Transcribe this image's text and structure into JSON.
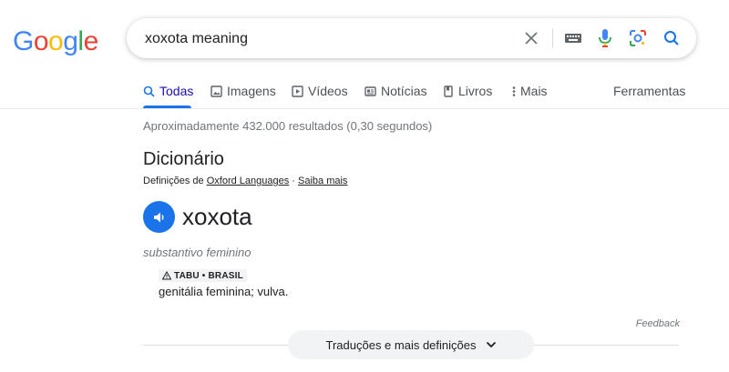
{
  "logo": {
    "letters": [
      "G",
      "o",
      "o",
      "g",
      "l",
      "e"
    ],
    "colors": [
      "#4285F4",
      "#EA4335",
      "#FBBC05",
      "#4285F4",
      "#34A853",
      "#EA4335"
    ]
  },
  "search": {
    "query": "xoxota meaning"
  },
  "tabs": [
    {
      "label": "Todas",
      "icon": "search-icon"
    },
    {
      "label": "Imagens",
      "icon": "image-icon"
    },
    {
      "label": "Vídeos",
      "icon": "video-icon"
    },
    {
      "label": "Notícias",
      "icon": "news-icon"
    },
    {
      "label": "Livros",
      "icon": "book-icon"
    },
    {
      "label": "Mais",
      "icon": "more-vert-icon"
    }
  ],
  "tools_label": "Ferramentas",
  "stats": "Aproximadamente 432.000 resultados (0,30 segundos)",
  "dictionary": {
    "title": "Dicionário",
    "source_prefix": "Definições de ",
    "source_link": "Oxford Languages",
    "separator": " · ",
    "learn_more": "Saiba mais",
    "word": "xoxota",
    "part_of_speech": "substantivo feminino",
    "badge": "TABU • BRASIL",
    "definition": "genitália feminina; vulva.",
    "feedback": "Feedback",
    "more_button": "Traduções e mais definições"
  },
  "colors": {
    "accent": "#1a73e8",
    "link": "#1a0dab"
  }
}
